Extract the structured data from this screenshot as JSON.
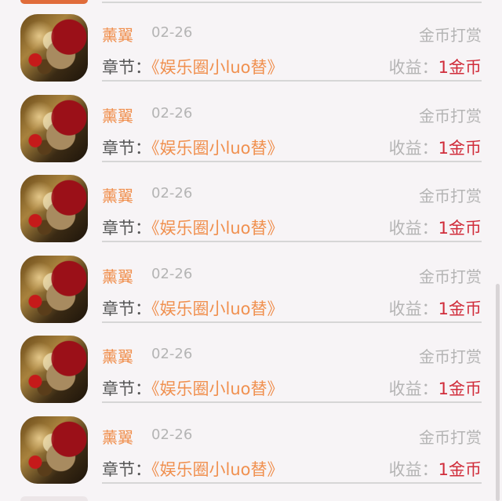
{
  "reward_list": {
    "items": [
      {
        "user": "薰翼",
        "date": "02-26",
        "action": "金币打赏",
        "chapter_label": "章节：",
        "chapter_title": "《娱乐圈小luo替》",
        "income_label": "收益：",
        "income_value": "1金币"
      },
      {
        "user": "薰翼",
        "date": "02-26",
        "action": "金币打赏",
        "chapter_label": "章节：",
        "chapter_title": "《娱乐圈小luo替》",
        "income_label": "收益：",
        "income_value": "1金币"
      },
      {
        "user": "薰翼",
        "date": "02-26",
        "action": "金币打赏",
        "chapter_label": "章节：",
        "chapter_title": "《娱乐圈小luo替》",
        "income_label": "收益：",
        "income_value": "1金币"
      },
      {
        "user": "薰翼",
        "date": "02-26",
        "action": "金币打赏",
        "chapter_label": "章节：",
        "chapter_title": "《娱乐圈小luo替》",
        "income_label": "收益：",
        "income_value": "1金币"
      },
      {
        "user": "薰翼",
        "date": "02-26",
        "action": "金币打赏",
        "chapter_label": "章节：",
        "chapter_title": "《娱乐圈小luo替》",
        "income_label": "收益：",
        "income_value": "1金币"
      },
      {
        "user": "薰翼",
        "date": "02-26",
        "action": "金币打赏",
        "chapter_label": "章节：",
        "chapter_title": "《娱乐圈小luo替》",
        "income_label": "收益：",
        "income_value": "1金币"
      }
    ]
  },
  "colors": {
    "background": "#f7f4f6",
    "user_name": "#f0904f",
    "chapter_title": "#f0904f",
    "income_value": "#d02c3a",
    "muted_text": "#b4b4b4",
    "divider": "#d6d6d6"
  }
}
